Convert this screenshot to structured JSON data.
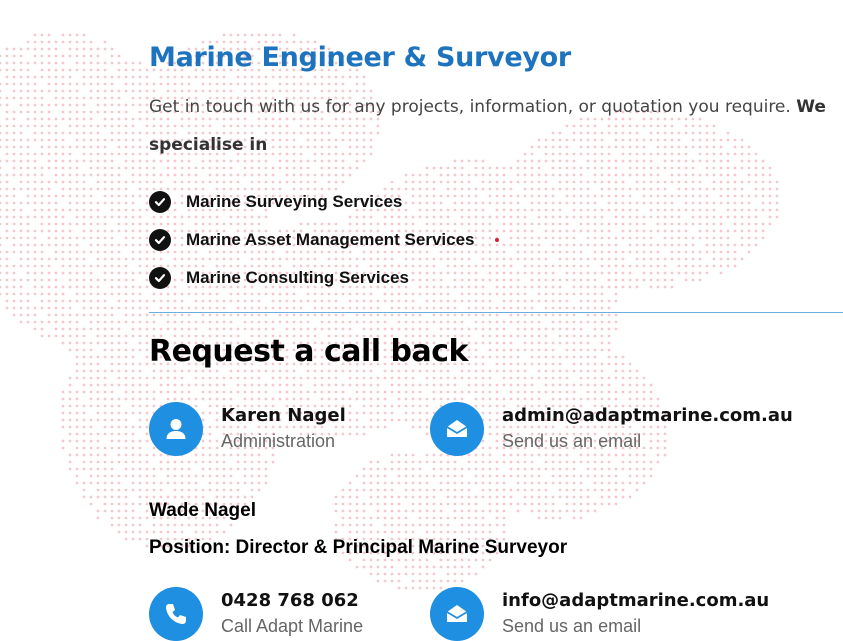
{
  "heading": "Marine Engineer & Surveyor",
  "intro": {
    "text": "Get in touch with us for any projects, information, or quotation you require.",
    "bold": "We specialise in"
  },
  "services": [
    "Marine Surveying Services",
    "Marine Asset Management Services",
    "Marine Consulting Services"
  ],
  "callback_heading": "Request a call back",
  "contacts": {
    "admin": {
      "name": "Karen Nagel",
      "role": "Administration",
      "icon": "user-icon"
    },
    "admin_email": {
      "email": "admin@adaptmarine.com.au",
      "label": "Send us an email",
      "icon": "envelope-icon"
    },
    "director": {
      "name": "Wade Nagel",
      "position": "Position: Director & Principal Marine Surveyor"
    },
    "phone": {
      "number": "0428 768 062",
      "label": "Call Adapt Marine",
      "icon": "phone-icon"
    },
    "info_email": {
      "email": "info@adaptmarine.com.au",
      "label": "Send us an email",
      "icon": "envelope-icon"
    }
  },
  "colors": {
    "accent_blue": "#1e73be",
    "icon_blue": "#1e8fe1",
    "divider": "#6aaee0",
    "dot_pattern": "#f2c9cf"
  }
}
